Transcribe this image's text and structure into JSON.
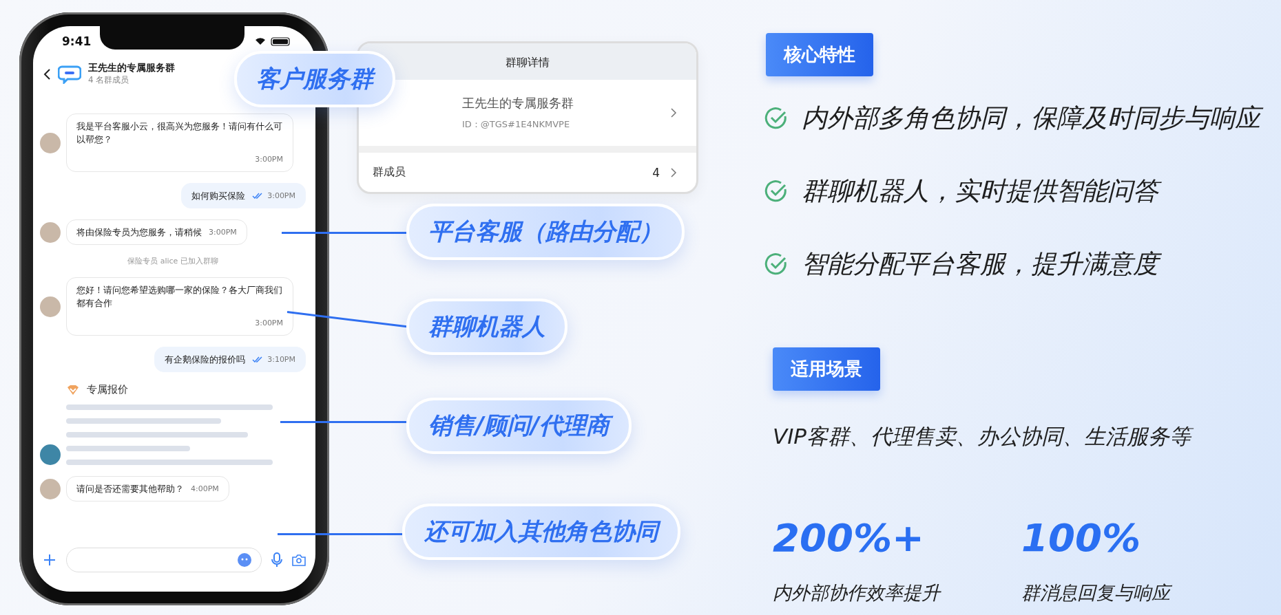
{
  "phone": {
    "status_bar": {
      "time": "9:41"
    },
    "chat_header": {
      "title": "王先生的专属服务群",
      "subtitle": "4 名群成员"
    },
    "messages": [
      {
        "kind": "incoming",
        "text": "我是平台客服小云，很高兴为您服务！请问有什么可以帮您？",
        "time": "3:00PM"
      },
      {
        "kind": "outgoing",
        "text": "如何购买保险",
        "time": "3:00PM",
        "read": true
      },
      {
        "kind": "incoming",
        "text": "将由保险专员为您服务，请稍候",
        "time": "3:00PM"
      },
      {
        "kind": "system",
        "text": "保险专员 alice 已加入群聊"
      },
      {
        "kind": "incoming",
        "text": "您好！请问您希望选购哪一家的保险？各大厂商我们都有合作",
        "time": "3:00PM"
      },
      {
        "kind": "outgoing",
        "text": "有企鹅保险的报价吗",
        "time": "3:10PM",
        "read": true
      },
      {
        "kind": "card",
        "title": "专属报价"
      },
      {
        "kind": "incoming",
        "text": "请问是否还需要其他帮助？",
        "time": "4:00PM"
      }
    ]
  },
  "detail_card": {
    "title": "群聊详情",
    "group_name": "王先生的专属服务群",
    "group_id": "ID：@TGS#1E4NKMVPE",
    "members_label": "群成员",
    "members_count": "4"
  },
  "callouts": [
    {
      "label": "客户服务群"
    },
    {
      "label": "平台客服（路由分配）"
    },
    {
      "label": "群聊机器人"
    },
    {
      "label": "销售/顾问/代理商"
    },
    {
      "label": "还可加入其他角色协同"
    }
  ],
  "features": {
    "badge": "核心特性",
    "items": [
      "内外部多角色协同，保障及时同步与响应",
      "群聊机器人，实时提供智能问答",
      "智能分配平台客服，提升满意度"
    ]
  },
  "scenarios": {
    "badge": "适用场景",
    "text": "VIP客群、代理售卖、办公协同、生活服务等"
  },
  "stats": [
    {
      "value": "200%+",
      "label": "内外部协作效率提升"
    },
    {
      "value": "100%",
      "label": "群消息回复与响应"
    }
  ]
}
